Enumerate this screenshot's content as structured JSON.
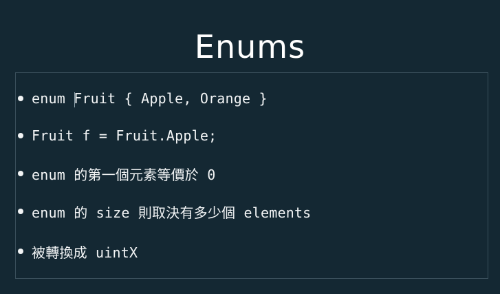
{
  "slide": {
    "title": "Enums",
    "bullets": [
      "enum Fruit { Apple, Orange }",
      "Fruit f = Fruit.Apple;",
      "enum 的第一個元素等價於 0",
      "enum 的 size 則取決有多少個 elements",
      "被轉換成 uintX"
    ]
  },
  "colors": {
    "background": "#142833",
    "text": "#f2f4f5",
    "box_border": "#3a4f5b"
  }
}
